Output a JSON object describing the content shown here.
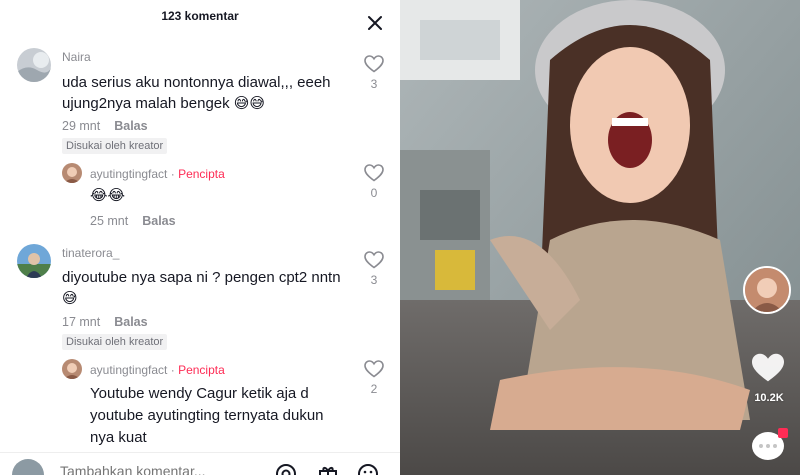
{
  "header": {
    "title": "123 komentar"
  },
  "comments": [
    {
      "username": "Naira",
      "text_lines": [
        "uda serius aku nontonnya diawal,,, eeeh",
        "ujung2nya malah bengek 😅😅"
      ],
      "time": "29 mnt",
      "reply_label": "Balas",
      "liked_by_creator": "Disukai oleh kreator",
      "likes": "3"
    },
    {
      "username": "ayutingtingfact",
      "separator": "·",
      "creator_label": "Pencipta",
      "text_lines": [
        "😂😂"
      ],
      "time": "25 mnt",
      "reply_label": "Balas",
      "likes": "0"
    },
    {
      "username": "tinaterora_",
      "text_lines": [
        "diyoutube nya sapa ni ? pengen cpt2 nntn",
        "😅"
      ],
      "time": "17 mnt",
      "reply_label": "Balas",
      "liked_by_creator": "Disukai oleh kreator",
      "likes": "3"
    },
    {
      "username": "ayutingtingfact",
      "separator": "·",
      "creator_label": "Pencipta",
      "text_lines": [
        "Youtube wendy Cagur ketik aja d",
        "youtube ayutingting ternyata dukun",
        "nya kuat"
      ],
      "likes": "2"
    }
  ],
  "compose": {
    "placeholder": "Tambahkan komentar..."
  },
  "video": {
    "like_count": "10.2K"
  },
  "colors": {
    "creator_accent": "#fe2c55",
    "muted": "#8a8b91",
    "text": "#161823"
  }
}
